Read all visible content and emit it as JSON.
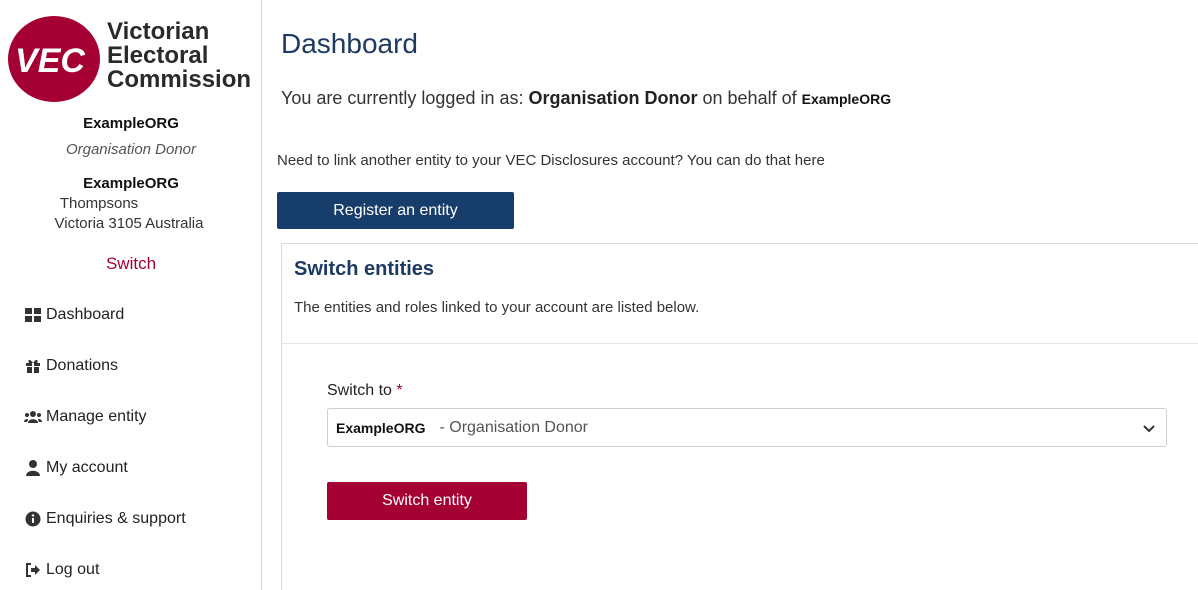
{
  "brand": {
    "logo_mark_text": "VEC",
    "name_line1": "Victorian",
    "name_line2": "Electoral",
    "name_line3": "Commission",
    "brand_color": "#a50034"
  },
  "sidebar": {
    "org_name": "ExampleORG",
    "org_role": "Organisation Donor",
    "address_name": "ExampleORG",
    "address_line1": "Thompsons",
    "address_line2": "Victoria 3105 Australia",
    "switch_label": "Switch",
    "nav": [
      {
        "label": "Dashboard",
        "icon": "grid-icon"
      },
      {
        "label": "Donations",
        "icon": "gift-icon"
      },
      {
        "label": "Manage entity",
        "icon": "users-icon"
      },
      {
        "label": "My account",
        "icon": "user-icon"
      },
      {
        "label": "Enquiries & support",
        "icon": "info-circle-icon"
      },
      {
        "label": "Log out",
        "icon": "sign-out-icon"
      }
    ]
  },
  "main": {
    "title": "Dashboard",
    "logged_prefix": "You are currently logged in as: ",
    "logged_role": "Organisation Donor",
    "logged_middle": " on behalf of ",
    "logged_org": "ExampleORG",
    "link_prompt": "Need to link another entity to your VEC Disclosures account? You can do that here",
    "register_button": "Register an entity",
    "card": {
      "title": "Switch entities",
      "subtitle": "The entities and roles linked to your account are listed below.",
      "field_label": "Switch to",
      "required_mark": "*",
      "selected_org": "ExampleORG",
      "selected_role": "- Organisation Donor",
      "switch_button": "Switch entity"
    }
  }
}
